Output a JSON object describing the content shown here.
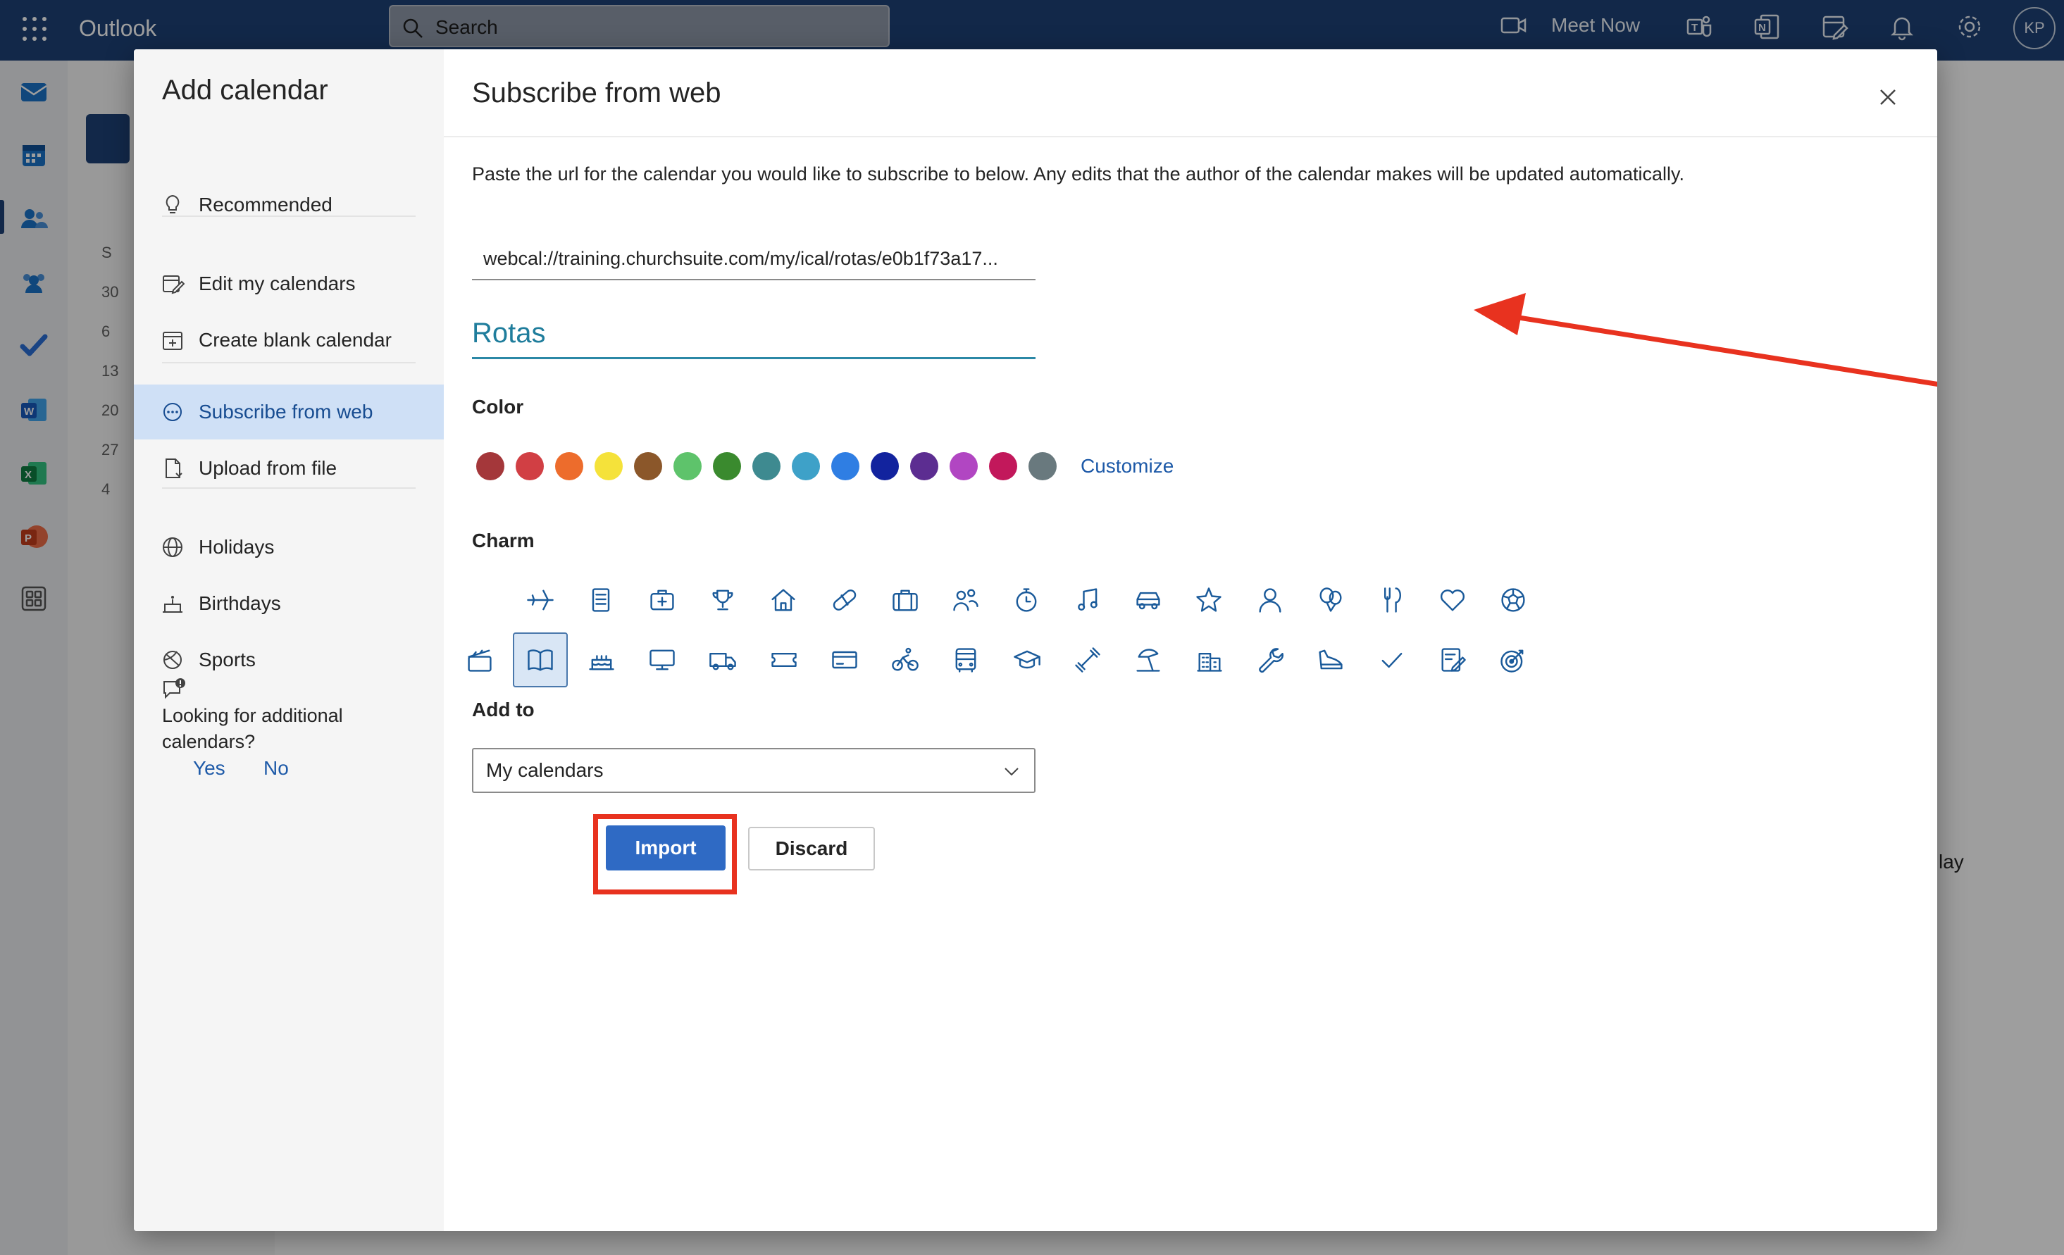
{
  "topbar": {
    "app_name": "Outlook",
    "search_label": "Search",
    "meet_now_label": "Meet Now",
    "avatar_initials": "KP",
    "icons": [
      "waffle-icon",
      "search-icon",
      "video-icon",
      "teams-icon",
      "onenote-icon",
      "my-day-icon",
      "bell-icon",
      "gear-icon"
    ]
  },
  "rail": {
    "apps": [
      "mail-icon",
      "calendar-icon",
      "people-icon",
      "groups-icon",
      "todo-icon",
      "word-icon",
      "excel-icon",
      "powerpoint-icon",
      "more-apps-icon"
    ]
  },
  "background": {
    "mini_calendar_days": [
      "S",
      "30",
      "6",
      "13",
      "20",
      "27",
      "4"
    ],
    "partial_day_label": "lay"
  },
  "dialog": {
    "nav": {
      "title": "Add calendar",
      "items": [
        {
          "label": "Recommended",
          "icon": "lightbulb-icon"
        },
        {
          "label": "Edit my calendars",
          "icon": "edit-calendar-icon"
        },
        {
          "label": "Create blank calendar",
          "icon": "calendar-add-icon"
        },
        {
          "label": "Subscribe from web",
          "icon": "web-subscribe-icon",
          "active": true
        },
        {
          "label": "Upload from file",
          "icon": "file-upload-icon"
        },
        {
          "label": "Holidays",
          "icon": "globe-icon"
        },
        {
          "label": "Birthdays",
          "icon": "cake-icon"
        },
        {
          "label": "Sports",
          "icon": "sports-ball-icon"
        }
      ],
      "feedback_question": "Looking for additional calendars?",
      "feedback_yes": "Yes",
      "feedback_no": "No"
    },
    "content": {
      "title": "Subscribe from web",
      "description": "Paste the url for the calendar you would like to subscribe to below. Any edits that the author of the calendar makes will be updated automatically.",
      "url_value": "webcal://training.churchsuite.com/my/ical/rotas/e0b1f73a17...",
      "calendar_name": "Rotas",
      "color_label": "Color",
      "colors": [
        "#a4373a",
        "#d13f44",
        "#ed6c2c",
        "#f5e23a",
        "#8b572a",
        "#5ec36b",
        "#3a8a2e",
        "#3e8a90",
        "#3ea1c8",
        "#2f7ee3",
        "#12239e",
        "#5c2d91",
        "#b146c2",
        "#c2185b",
        "#69797e"
      ],
      "customize_label": "Customize",
      "charm_label": "Charm",
      "charms_row1": [
        "airplane-icon",
        "notepad-icon",
        "first-aid-kit-icon",
        "trophy-icon",
        "home-icon",
        "pill-icon",
        "briefcase-icon",
        "people-icon",
        "stopwatch-icon",
        "music-note-icon",
        "car-icon",
        "star-icon",
        "person-icon",
        "balloons-icon",
        "fork-knife-icon",
        "heart-icon",
        "soccer-ball-icon"
      ],
      "charms_row2": [
        "clapperboard-icon",
        "open-book-icon",
        "birthday-cake-icon",
        "monitor-icon",
        "truck-icon",
        "ticket-icon",
        "credit-card-icon",
        "cyclist-icon",
        "bus-icon",
        "graduation-cap-icon",
        "dumbbell-icon",
        "beach-icon",
        "building-icon",
        "wrench-icon",
        "sneaker-icon",
        "checkmark-icon",
        "note-edit-icon",
        "target-icon"
      ],
      "selected_charm": "open-book-icon",
      "add_to_label": "Add to",
      "add_to_value": "My calendars",
      "import_label": "Import",
      "discard_label": "Discard"
    }
  },
  "accents": {
    "brand": "#1d4276",
    "primary_button": "#2f6ac4",
    "highlight_annotation": "#e8321f"
  }
}
